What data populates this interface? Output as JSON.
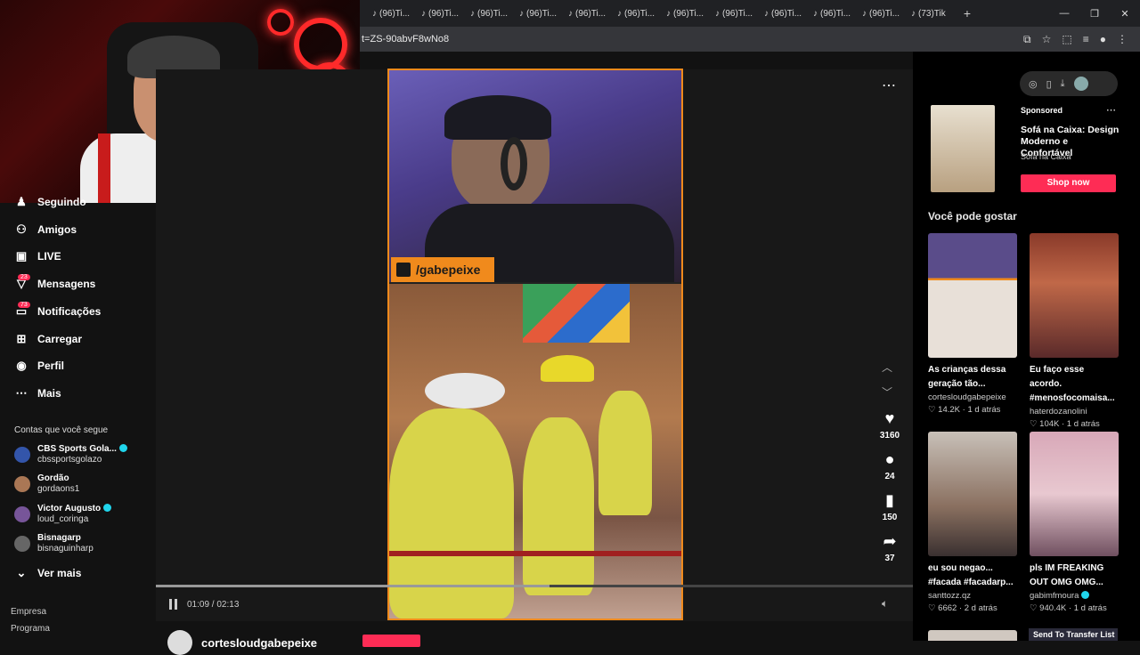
{
  "browser": {
    "tab_label": "(96)Ti...",
    "tab_count": 12,
    "last_tab_label": "(73)Tik",
    "new_tab": "+",
    "url": "t=ZS-90abvF8wNo8",
    "win_min": "—",
    "win_max": "❐",
    "win_close": "✕"
  },
  "left_nav": {
    "items": [
      {
        "label": "Seguindo",
        "icon": "following-icon"
      },
      {
        "label": "Amigos",
        "icon": "friends-icon"
      },
      {
        "label": "LIVE",
        "icon": "live-icon"
      },
      {
        "label": "Mensagens",
        "icon": "messages-icon",
        "badge": "23"
      },
      {
        "label": "Notificações",
        "icon": "notifications-icon",
        "badge": "73"
      },
      {
        "label": "Carregar",
        "icon": "upload-icon"
      },
      {
        "label": "Perfil",
        "icon": "profile-icon"
      },
      {
        "label": "Mais",
        "icon": "more-icon"
      }
    ],
    "following_header": "Contas que você segue",
    "accounts": [
      {
        "name": "CBS Sports Gola...",
        "handle": "cbssportsgolazo",
        "verified": true
      },
      {
        "name": "Gordão",
        "handle": "gordaons1",
        "verified": false
      },
      {
        "name": "Victor Augusto",
        "handle": "loud_coringa",
        "verified": true
      },
      {
        "name": "Bisnagarp",
        "handle": "bisnaguinharp",
        "verified": false
      }
    ],
    "see_more": "Ver mais",
    "footer": [
      "Empresa",
      "Programa"
    ]
  },
  "video": {
    "overlay_tag": "/gabepeixe",
    "time": "01:09 / 02:13",
    "progress": 0.52,
    "likes": "3160",
    "comments": "24",
    "saves": "150",
    "shares": "37",
    "author": "cortesloudgabepeixe"
  },
  "ad": {
    "sponsored": "Sponsored",
    "title": "Sofá na Caixa: Design Moderno e Confortável",
    "advertiser": "Sofá na Caixa",
    "cta": "Shop now"
  },
  "recommendations": {
    "header": "Você pode gostar",
    "cards": [
      {
        "title": "As crianças dessa geração tão...",
        "author": "cortesloudgabepeixe",
        "verified": false,
        "likes": "14.2K",
        "ago": "1 d atrás"
      },
      {
        "title": "Eu faço esse acordo. #menosfocomaisa...",
        "author": "haterdozanolini",
        "verified": false,
        "likes": "104K",
        "ago": "1 d atrás"
      },
      {
        "title": "eu sou negao... #facada #facadarp...",
        "author": "santtozz.qz",
        "verified": false,
        "likes": "6662",
        "ago": "2 d atrás"
      },
      {
        "title": "pls IM FREAKING OUT OMG OMG...",
        "author": "gabimfmoura",
        "verified": true,
        "likes": "940.4K",
        "ago": "1 d atrás"
      }
    ],
    "send_to_list": "Send To Transfer List"
  },
  "colors": {
    "accent": "#fe2c55",
    "overlay": "#f08a1c",
    "verified": "#20d5ec"
  }
}
